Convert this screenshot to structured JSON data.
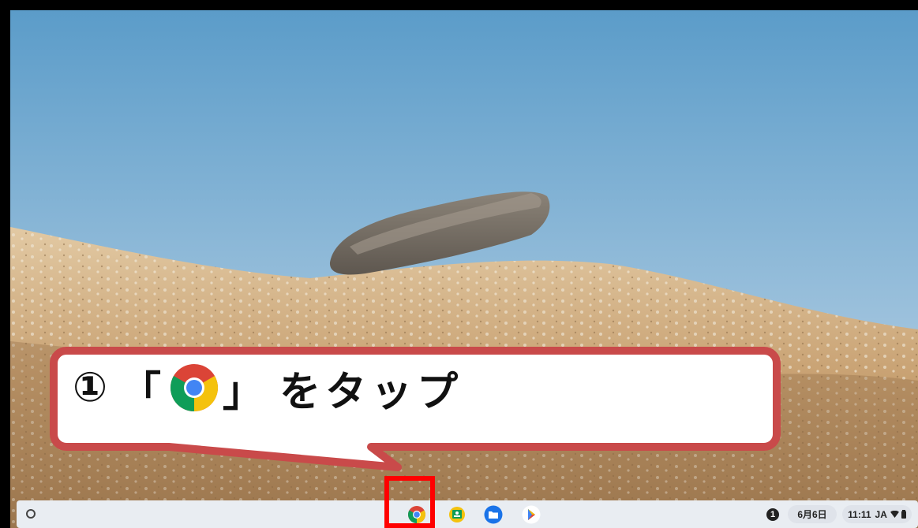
{
  "instruction": {
    "step_number": "①",
    "open_bracket": "「",
    "close_bracket": "」",
    "action": "をタップ",
    "icon": "chrome-icon"
  },
  "shelf": {
    "apps": [
      {
        "name": "chrome",
        "icon": "chrome-icon"
      },
      {
        "name": "classroom",
        "icon": "classroom-icon"
      },
      {
        "name": "files",
        "icon": "files-icon"
      },
      {
        "name": "play-store",
        "icon": "play-store-icon"
      }
    ],
    "tray": {
      "notification_count": "1",
      "date": "6月6日",
      "time": "11:11",
      "locale": "JA"
    }
  },
  "colors": {
    "highlight": "#ff0000",
    "callout_border": "#c94a4a",
    "callout_fill": "#ffffff"
  }
}
